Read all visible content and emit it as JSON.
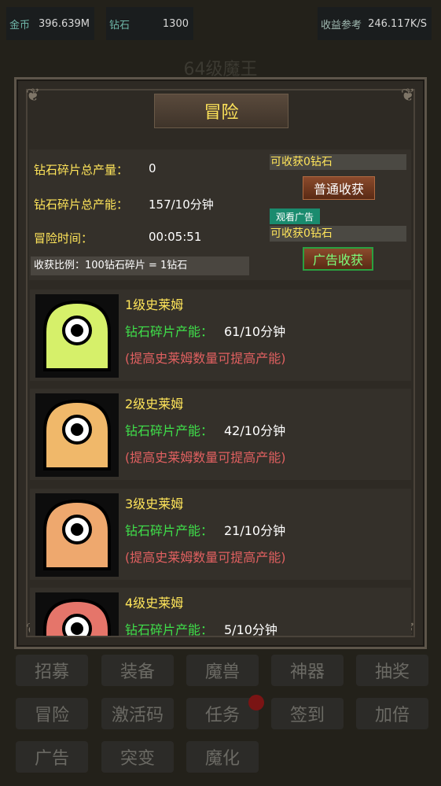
{
  "top_bar": {
    "gold_label": "金币",
    "gold_value": "396.639M",
    "gem_label": "钻石",
    "gem_value": "1300",
    "income_label": "收益参考",
    "income_value": "246.117K/S"
  },
  "background_title": "64级魔王",
  "panel": {
    "title": "冒险",
    "info": {
      "total_output_label": "钻石碎片总产量：",
      "total_output_value": "0",
      "total_rate_label": "钻石碎片总产能：",
      "total_rate_value": "157/10分钟",
      "time_label": "冒险时间：",
      "time_value": "00:05:51",
      "ratio_text": "收获比例：100钻石碎片 = 1钻石"
    },
    "harvest": {
      "normal_available": "可收获0钻石",
      "normal_button": "普通收获",
      "ad_tag": "观看广告",
      "ad_available": "可收获0钻石",
      "ad_button": "广告收获"
    },
    "slimes": [
      {
        "name": "1级史莱姆",
        "rate_label": "钻石碎片产能：",
        "rate_value": "61/10分钟",
        "tip": "(提高史莱姆数量可提高产能)",
        "color": "#d6f06a"
      },
      {
        "name": "2级史莱姆",
        "rate_label": "钻石碎片产能：",
        "rate_value": "42/10分钟",
        "tip": "(提高史莱姆数量可提高产能)",
        "color": "#f0b86a"
      },
      {
        "name": "3级史莱姆",
        "rate_label": "钻石碎片产能：",
        "rate_value": "21/10分钟",
        "tip": "(提高史莱姆数量可提高产能)",
        "color": "#eea86e"
      },
      {
        "name": "4级史莱姆",
        "rate_label": "钻石碎片产能：",
        "rate_value": "5/10分钟",
        "tip": "",
        "color": "#e5756a"
      }
    ]
  },
  "nav": {
    "row1": [
      "招募",
      "装备",
      "魔兽",
      "神器",
      "抽奖"
    ],
    "row2": [
      "冒险",
      "激活码",
      "任务",
      "签到",
      "加倍"
    ],
    "row3": [
      "广告",
      "突变",
      "魔化"
    ]
  }
}
